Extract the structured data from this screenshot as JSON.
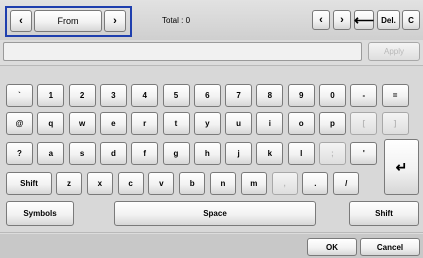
{
  "header": {
    "from_label": "From",
    "total_label": "Total : 0",
    "del_label": "Del.",
    "clear_label": "C"
  },
  "input": {
    "value": "",
    "apply_label": "Apply"
  },
  "keyboard": {
    "row1": [
      "`",
      "1",
      "2",
      "3",
      "4",
      "5",
      "6",
      "7",
      "8",
      "9",
      "0",
      "-",
      "="
    ],
    "row2": [
      "@",
      "q",
      "w",
      "e",
      "r",
      "t",
      "y",
      "u",
      "i",
      "o",
      "p",
      "[",
      "]"
    ],
    "row3": [
      "?",
      "a",
      "s",
      "d",
      "f",
      "g",
      "h",
      "j",
      "k",
      "l",
      ";",
      "'"
    ],
    "row4": [
      "z",
      "x",
      "c",
      "v",
      "b",
      "n",
      "m",
      ",",
      ".",
      "/"
    ],
    "shift_label": "Shift",
    "symbols_label": "Symbols",
    "space_label": "Space",
    "enter_symbol": "↵"
  },
  "footer": {
    "ok_label": "OK",
    "cancel_label": "Cancel"
  },
  "colors": {
    "highlight_border": "#1f3fae",
    "background": "#dcdcdc"
  }
}
